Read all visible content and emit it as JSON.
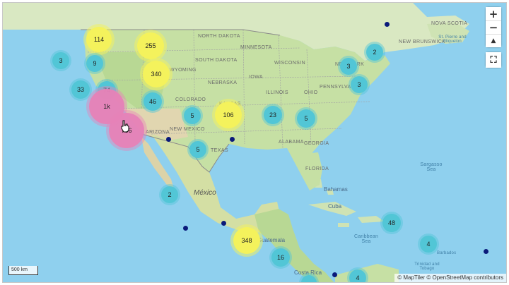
{
  "map": {
    "controls": {
      "zoom_in": "+",
      "zoom_out": "−",
      "compass": "▲",
      "fullscreen": "⛶"
    },
    "scale_label": "500 km",
    "attribution": "© MapTiler © OpenStreetMap contributors",
    "labels": {
      "north_dakota": "NORTH DAKOTA",
      "minnesota": "MINNESOTA",
      "south_dakota": "SOUTH DAKOTA",
      "wisconsin": "WISCONSIN",
      "wyoming": "WYOMING",
      "iowa": "IOWA",
      "nebraska": "NEBRASKA",
      "illinois": "ILLINOIS",
      "ohio": "OHIO",
      "pennsylvania": "PENNSYLVANIA",
      "new_york": "NEW YORK",
      "colorado": "COLORADO",
      "kansas": "KANSAS",
      "arizona": "ARIZONA",
      "new_mexico": "NEW MEXICO",
      "texas": "TEXAS",
      "alabama": "ALABAMA",
      "georgia": "GEORGIA",
      "florida": "FLORIDA",
      "new_brunswick": "NEW BRUNSWICK",
      "nova_scotia": "NOVA SCOTIA",
      "mexico": "México",
      "cuba": "Cuba",
      "bahamas": "Bahamas",
      "guatemala": "Guatemala",
      "costa_rica": "Costa Rica",
      "caribbean_sea": "Caribbean Sea",
      "sargasso_sea": "Sargasso Sea",
      "st_pierre": "St. Pierre and Miquelon",
      "trinidad": "Trinidad and Tobago",
      "barbados": "Barbados"
    },
    "clusters": [
      {
        "name": "cluster-114",
        "count": "114",
        "tier": "yellow"
      },
      {
        "name": "cluster-255",
        "count": "255",
        "tier": "yellow"
      },
      {
        "name": "cluster-3-pacific",
        "count": "3",
        "tier": "teal"
      },
      {
        "name": "cluster-9",
        "count": "9",
        "tier": "teal"
      },
      {
        "name": "cluster-340",
        "count": "340",
        "tier": "yellow"
      },
      {
        "name": "cluster-33",
        "count": "33",
        "tier": "teal"
      },
      {
        "name": "cluster-74",
        "count": "74",
        "tier": "teal"
      },
      {
        "name": "cluster-1k",
        "count": "1k",
        "tier": "pink"
      },
      {
        "name": "cluster-46",
        "count": "46",
        "tier": "teal"
      },
      {
        "name": "cluster-5-colorado",
        "count": "5",
        "tier": "teal"
      },
      {
        "name": "cluster-106",
        "count": "106",
        "tier": "yellow"
      },
      {
        "name": "cluster-23",
        "count": "23",
        "tier": "teal"
      },
      {
        "name": "cluster-5-southeast",
        "count": "5",
        "tier": "teal"
      },
      {
        "name": "cluster-3-northeast",
        "count": "3",
        "tier": "teal"
      },
      {
        "name": "cluster-3-east-coast",
        "count": "3",
        "tier": "teal"
      },
      {
        "name": "cluster-2-newengland",
        "count": "2",
        "tier": "teal"
      },
      {
        "name": "cluster-756",
        "count": "756",
        "tier": "pink"
      },
      {
        "name": "cluster-5-texas",
        "count": "5",
        "tier": "teal"
      },
      {
        "name": "cluster-2-mexico",
        "count": "2",
        "tier": "teal"
      },
      {
        "name": "cluster-348",
        "count": "348",
        "tier": "yellow"
      },
      {
        "name": "cluster-16",
        "count": "16",
        "tier": "teal"
      },
      {
        "name": "cluster-48",
        "count": "48",
        "tier": "teal"
      },
      {
        "name": "cluster-4-caribbean",
        "count": "4",
        "tier": "teal"
      },
      {
        "name": "cluster-4-south",
        "count": "4",
        "tier": "teal"
      }
    ]
  }
}
